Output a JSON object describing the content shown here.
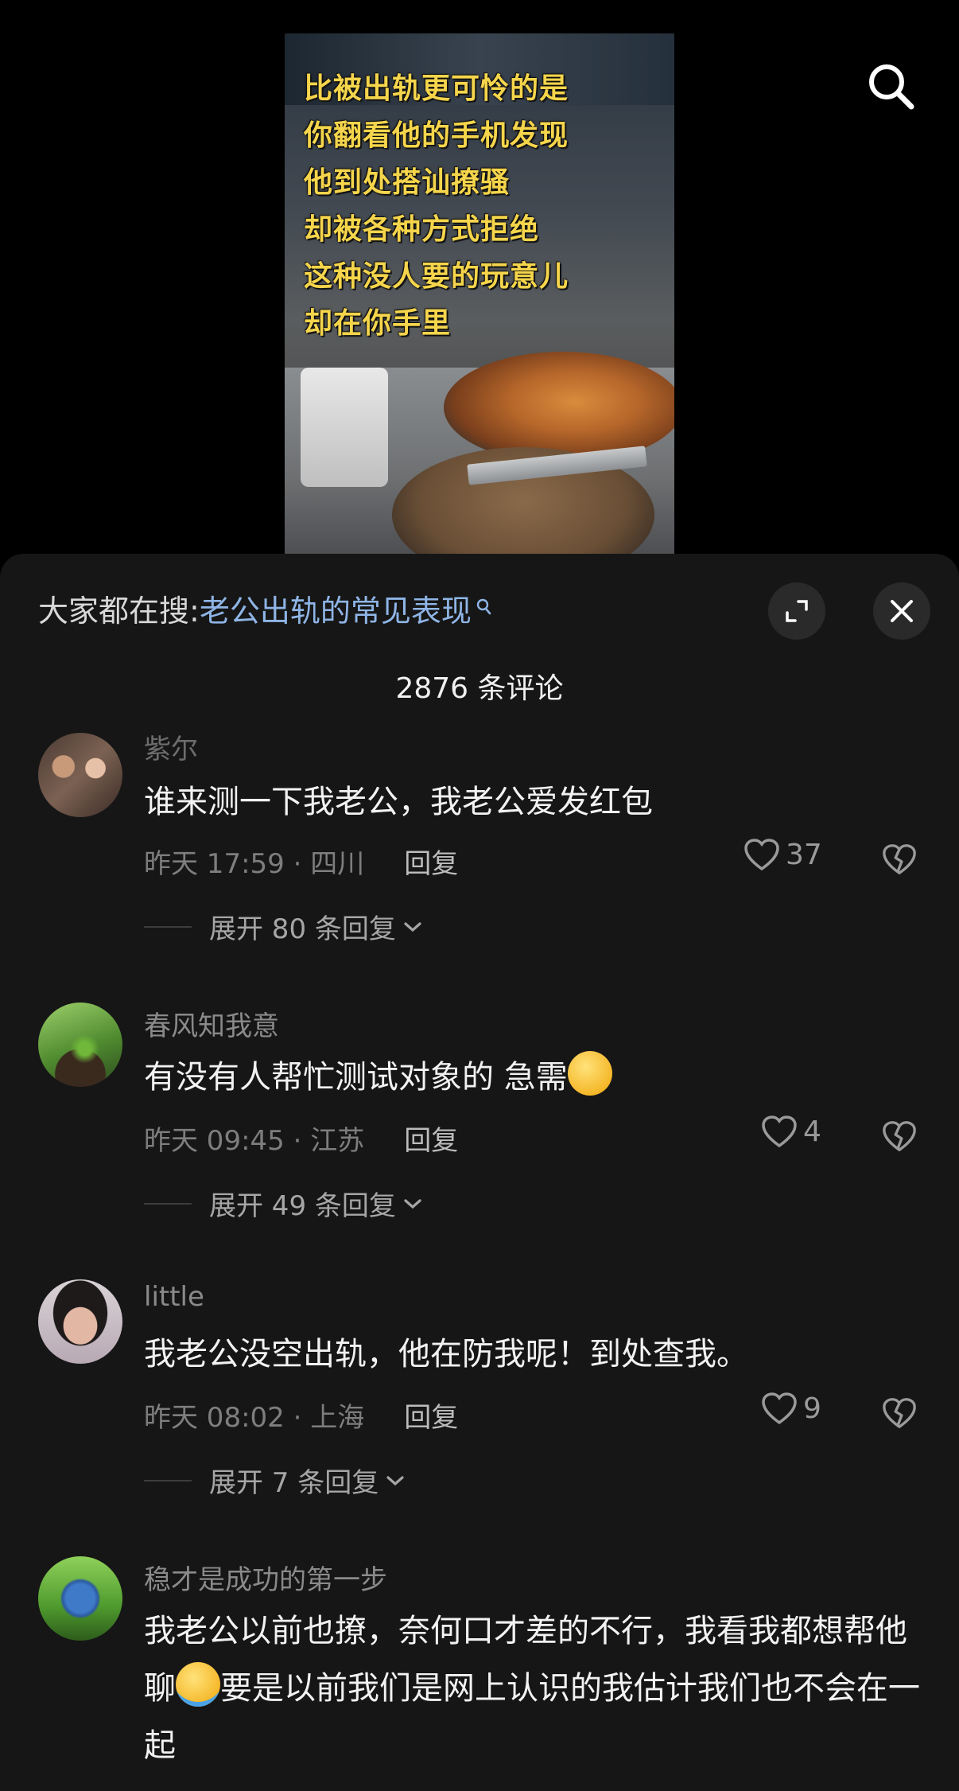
{
  "video": {
    "caption_lines": [
      "比被出轨更可怜的是",
      "你翻看他的手机发现",
      "他到处搭讪撩骚",
      "却被各种方式拒绝",
      "这种没人要的玩意儿",
      "却在你手里"
    ]
  },
  "sheet": {
    "search_lead": "大家都在搜:",
    "search_term": "老公出轨的常见表现",
    "comment_count": "2876 条评论"
  },
  "comments": [
    {
      "username": "紫尔",
      "text": "谁来测一下我老公，我老公爱发红包",
      "time_loc": "昨天 17:59 · 四川",
      "reply": "回复",
      "likes": "37",
      "expand": "展开 80 条回复"
    },
    {
      "username": "春风知我意",
      "text": "有没有人帮忙测试对象的  急需",
      "time_loc": "昨天 09:45 · 江苏",
      "reply": "回复",
      "likes": "4",
      "expand": "展开 49 条回复"
    },
    {
      "username": "little",
      "text": "我老公没空出轨，他在防我呢！到处查我。",
      "time_loc": "昨天 08:02 · 上海",
      "reply": "回复",
      "likes": "9",
      "expand": "展开 7 条回复"
    },
    {
      "username": "稳才是成功的第一步",
      "text_a": "我老公以前也撩，奈何口才差的不行，我看我都想帮他聊",
      "text_b": "要是以前我们是网上认识的我估计我们也不会在一起"
    }
  ],
  "icons": {
    "search": "search-icon",
    "expand": "expand-icon",
    "close": "close-icon",
    "heart": "heart-icon",
    "broken_heart": "broken-heart-icon",
    "chevron": "chevron-down-icon"
  }
}
